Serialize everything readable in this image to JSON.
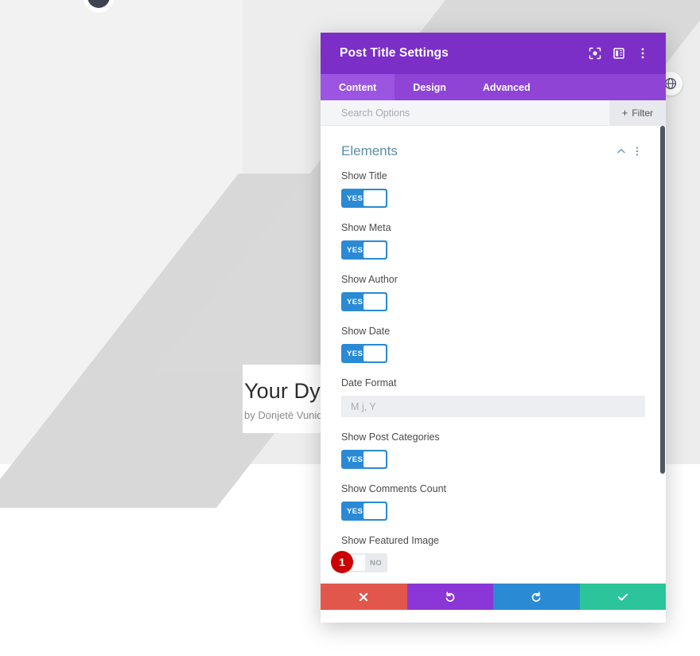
{
  "background": {
    "post_title": "Your Dyna",
    "byline": "by Donjetë Vuniqi",
    "avatar_name": "author-avatar",
    "round_button_icon": "globe-icon"
  },
  "modal": {
    "title": "Post Title Settings",
    "header_icons": [
      {
        "name": "focus-target-icon",
        "label": "focus"
      },
      {
        "name": "layout-panel-icon",
        "label": "layout"
      },
      {
        "name": "more-vertical-icon",
        "label": "more"
      }
    ],
    "tabs": [
      {
        "label": "Content",
        "active": true
      },
      {
        "label": "Design",
        "active": false
      },
      {
        "label": "Advanced",
        "active": false
      }
    ],
    "search": {
      "value": "",
      "placeholder": "Search Options"
    },
    "filter": {
      "label": "Filter",
      "plus": "+"
    },
    "section": {
      "title": "Elements",
      "collapse_icon": "chevron-up-icon",
      "menu_icon": "more-vertical-icon"
    },
    "fields": [
      {
        "label": "Show Title",
        "type": "toggle",
        "value": "YES",
        "state": "on"
      },
      {
        "label": "Show Meta",
        "type": "toggle",
        "value": "YES",
        "state": "on"
      },
      {
        "label": "Show Author",
        "type": "toggle",
        "value": "YES",
        "state": "on"
      },
      {
        "label": "Show Date",
        "type": "toggle",
        "value": "YES",
        "state": "on"
      },
      {
        "label": "Date Format",
        "type": "text",
        "value": "",
        "placeholder": "M j, Y"
      },
      {
        "label": "Show Post Categories",
        "type": "toggle",
        "value": "YES",
        "state": "on"
      },
      {
        "label": "Show Comments Count",
        "type": "toggle",
        "value": "YES",
        "state": "on"
      },
      {
        "label": "Show Featured Image",
        "type": "toggle",
        "value": "NO",
        "state": "off",
        "badge": "1"
      }
    ],
    "footer_buttons": [
      {
        "name": "cancel-button",
        "icon": "close-icon",
        "color": "#e2574c"
      },
      {
        "name": "undo-button",
        "icon": "undo-icon",
        "color": "#8b36d6"
      },
      {
        "name": "redo-button",
        "icon": "redo-icon",
        "color": "#2a8ad4"
      },
      {
        "name": "save-button",
        "icon": "checkmark-icon",
        "color": "#2cc49a"
      }
    ]
  },
  "colors": {
    "header_purple": "#7b2fc7",
    "tab_purple": "#8f44d6",
    "tab_active_purple": "#9b55e0",
    "toggle_blue": "#2a8ad4",
    "badge_red": "#cc0000",
    "section_title": "#5a8ca8"
  }
}
